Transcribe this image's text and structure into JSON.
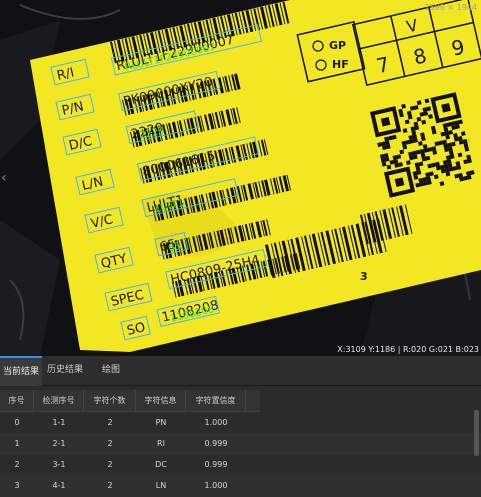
{
  "viewer": {
    "image_size": "2598 × 1944",
    "pixel_info": "X:3109  Y:1186  | R:020  G:021  B:023",
    "left_arrow": "‹"
  },
  "label": {
    "fields": [
      "R/I",
      "P/N",
      "D/C",
      "L/N",
      "V/C",
      "QTY",
      "SPEC",
      "SO"
    ],
    "values": [
      "RLULT1F22900007",
      "PK09000XY20",
      "2229",
      "800061615",
      "LULT1",
      "65",
      "HC0809-25H4",
      "1108208"
    ],
    "ocr_overlay": [
      "RLULT1F22900007",
      "",
      "2229",
      "",
      "LULT1",
      "65",
      "",
      "1108208"
    ],
    "grid_letters": [
      "V",
      "7",
      "8",
      "9"
    ],
    "gp": "GP",
    "hf": "HF",
    "digit": "3"
  },
  "tabs": [
    "当前结果",
    "历史结果",
    "绘图"
  ],
  "table": {
    "headers": [
      "序号",
      "检测序号",
      "字符个数",
      "字符信息",
      "字符置信度"
    ],
    "rows": [
      [
        "0",
        "1-1",
        "2",
        "PN",
        "1.000"
      ],
      [
        "1",
        "2-1",
        "2",
        "RI",
        "0.999"
      ],
      [
        "2",
        "3-1",
        "2",
        "DC",
        "0.999"
      ],
      [
        "3",
        "4-1",
        "2",
        "LN",
        "1.000"
      ]
    ]
  }
}
